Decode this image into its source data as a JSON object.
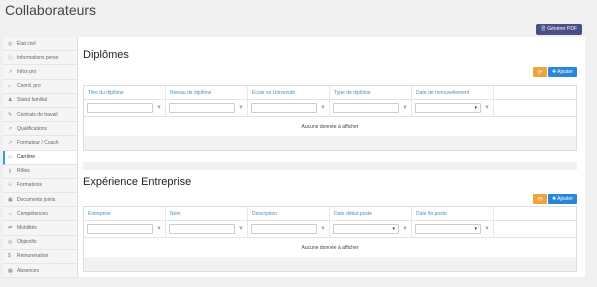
{
  "header": {
    "title": "Collaborateurs",
    "pdf_button": "Générer PDF",
    "pdf_icon": "file-icon"
  },
  "sidebar": {
    "items": [
      {
        "label": "État civil",
        "icon": "target-icon"
      },
      {
        "label": "Informations perso",
        "icon": "info-icon"
      },
      {
        "label": "Infos pro",
        "icon": "chart-icon"
      },
      {
        "label": "Coord. pro",
        "icon": "address-icon"
      },
      {
        "label": "Statut familial",
        "icon": "family-icon"
      },
      {
        "label": "Contrats de travail",
        "icon": "contract-icon"
      },
      {
        "label": "Qualifications",
        "icon": "chart-icon"
      },
      {
        "label": "Formateur / Coach",
        "icon": "chart-icon"
      },
      {
        "label": "Carrière",
        "icon": "laptop-icon",
        "active": true
      },
      {
        "label": "Rôles",
        "icon": "key-icon"
      },
      {
        "label": "Formations",
        "icon": "group-icon"
      },
      {
        "label": "Documents joints",
        "icon": "folder-icon"
      },
      {
        "label": "Compétences",
        "icon": "bulb-icon"
      },
      {
        "label": "Mobilités",
        "icon": "exchange-icon"
      },
      {
        "label": "Objectifs",
        "icon": "target-icon"
      },
      {
        "label": "Rémunération",
        "icon": "dollar-icon"
      },
      {
        "label": "Absences",
        "icon": "calendar-icon"
      }
    ]
  },
  "diplomes": {
    "title": "Diplômes",
    "add_label": "Ajouter",
    "columns": [
      "Titre du diplôme",
      "Niveau de diplôme",
      "École ou Université",
      "Type de diplôme",
      "Date de renouvellement"
    ],
    "empty": "Aucune donnée à afficher"
  },
  "experience": {
    "title": "Expérience Entreprise",
    "add_label": "Ajouter",
    "columns": [
      "Entreprise",
      "Nom",
      "Description",
      "Date début poste",
      "Date fin poste"
    ],
    "empty": "Aucune donnée à afficher"
  },
  "colors": {
    "accent_blue": "#2a86d9",
    "accent_orange": "#f0a33a",
    "pdf_button": "#4a4f86",
    "header_text": "#4a90c0"
  }
}
